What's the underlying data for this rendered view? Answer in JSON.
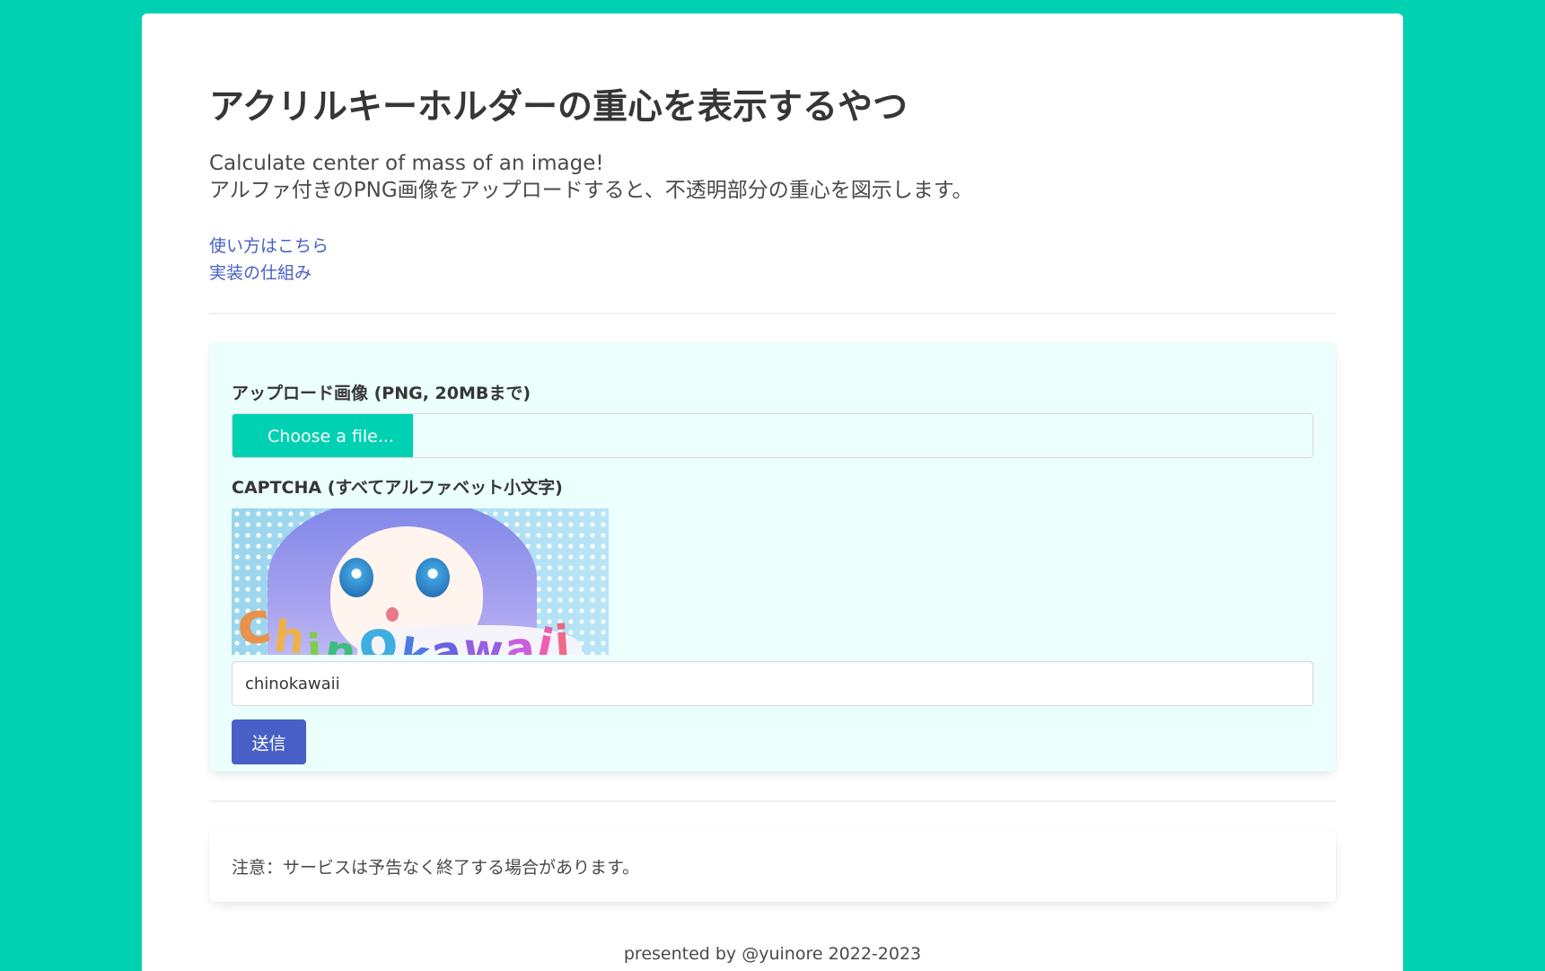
{
  "header": {
    "title": "アクリルキーホルダーの重心を表示するやつ",
    "subtitle_line1": "Calculate center of mass of an image!",
    "subtitle_line2": "アルファ付きのPNG画像をアップロードすると、不透明部分の重心を図示します。"
  },
  "links": {
    "how_to": "使い方はこちら",
    "implementation": "実装の仕組み"
  },
  "form": {
    "upload_label": "アップロード画像 (PNG, 20MBまで)",
    "file_button": "Choose a file...",
    "captcha_label": "CAPTCHA (すべてアルファベット小文字)",
    "captcha_text": "chinokawaii",
    "captcha_letter_colors": [
      "#f08a3a",
      "#f4b23a",
      "#7ccf3a",
      "#2fbf6f",
      "#2aa7e0",
      "#3a6fe0",
      "#5a54e0",
      "#8b4fe0",
      "#c64fd8",
      "#ee4fa8",
      "#f05a7a"
    ],
    "captcha_input_value": "chinokawaii",
    "submit_label": "送信"
  },
  "notice": {
    "text": "注意：サービスは予告なく終了する場合があります。"
  },
  "footer": {
    "text": "presented by @yuinore 2022-2023"
  },
  "colors": {
    "background": "#00d1b2",
    "link": "#485fc7",
    "form_bg": "#ebfffc",
    "submit": "#485fc7"
  }
}
